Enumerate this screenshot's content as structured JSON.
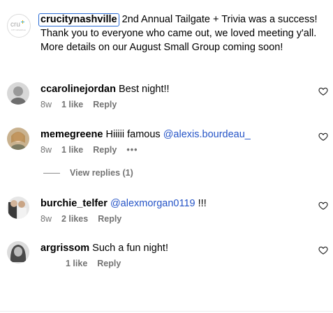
{
  "caption": {
    "username": "crucitynashville",
    "text_line1_rest": "2nd Annual Tailgate + Trivia was a success!",
    "text_line2": "Thank you to everyone who came out, we loved meeting y'all.",
    "text_line3": "More details on our August Small Group coming soon!",
    "logo": {
      "text": "cru",
      "small": "CITY NASHVILLE"
    }
  },
  "comments": [
    {
      "username": "ccarolinejordan",
      "text": "Best night!!",
      "time": "8w",
      "likes": "1 like",
      "reply": "Reply"
    },
    {
      "username": "memegreene",
      "text": "Hiiiii famous",
      "mention": "@alexis.bourdeau_",
      "time": "8w",
      "likes": "1 like",
      "reply": "Reply",
      "more": "•••"
    },
    {
      "username": "burchie_telfer",
      "mention": "@alexmorgan0119",
      "text": "!!!",
      "time": "8w",
      "likes": "2 likes",
      "reply": "Reply"
    },
    {
      "username": "argrissom",
      "text": "Such a fun night!",
      "likes": "1 like",
      "reply": "Reply"
    }
  ],
  "view_replies": "View replies (1)",
  "colors": {
    "mention": "#2554c7",
    "meta": "#737373",
    "highlight": "#2a6bd4"
  }
}
